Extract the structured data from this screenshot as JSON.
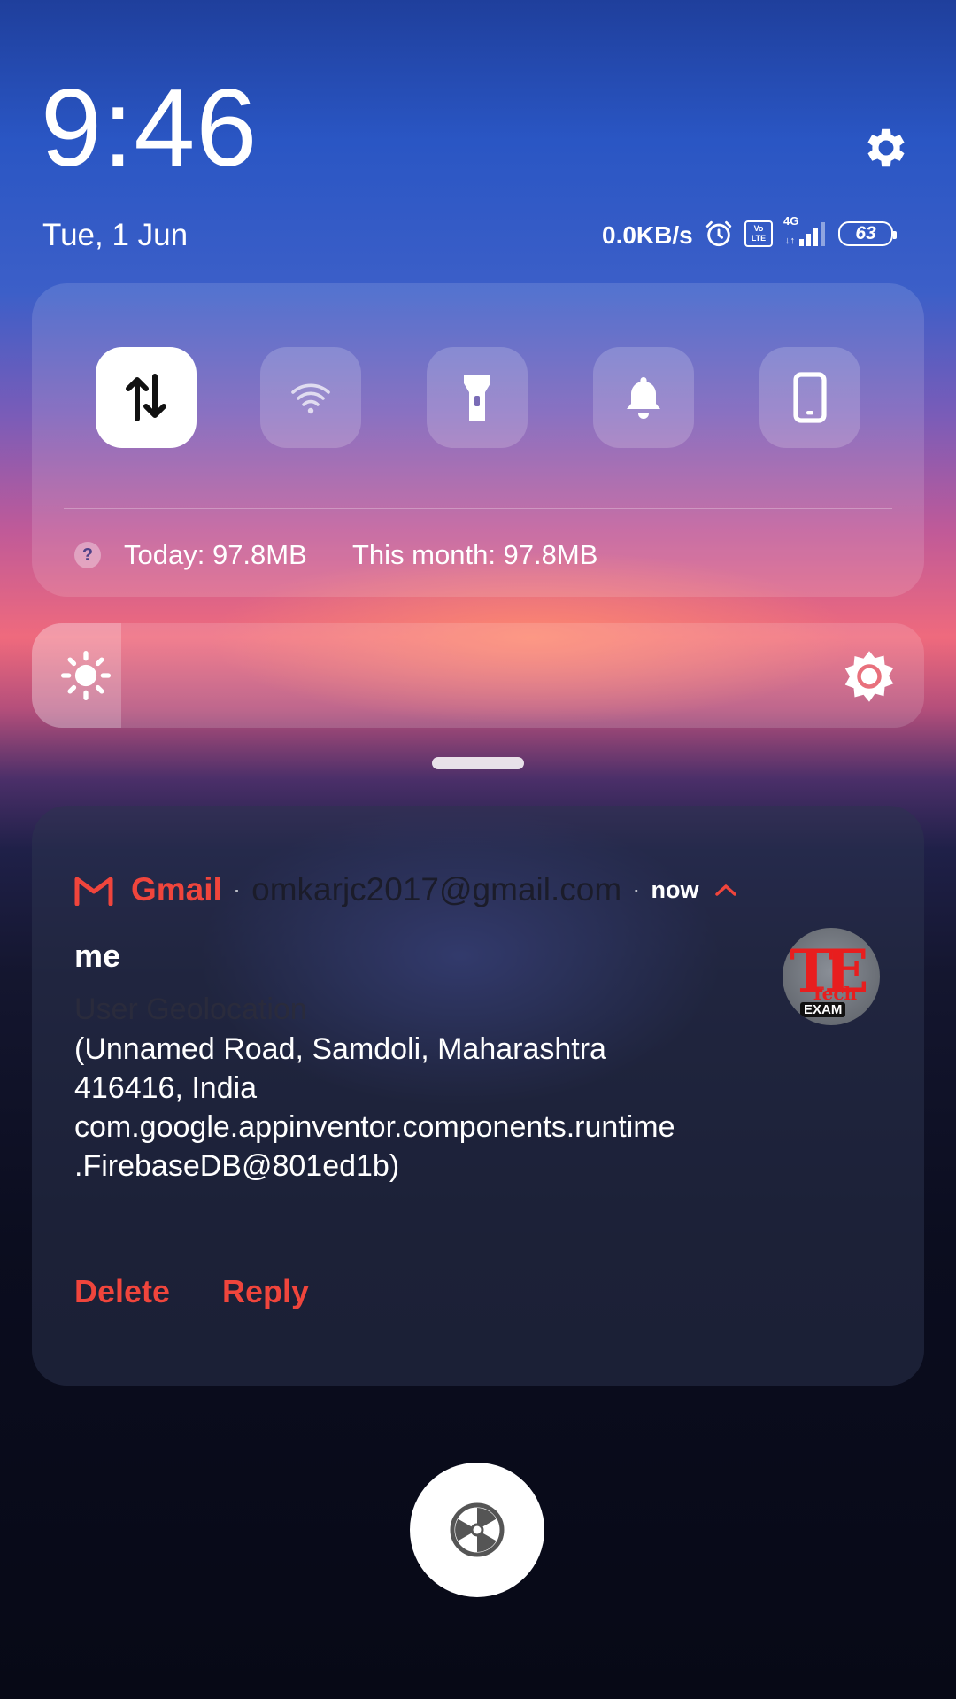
{
  "clock": {
    "time": "9:46",
    "date": "Tue, 1 Jun"
  },
  "status_bar": {
    "net_speed": "0.0KB/s",
    "network_type": "4G",
    "volte": "Vo LTE",
    "battery_level": "63",
    "icons": [
      "alarm-icon",
      "volte-icon",
      "signal-icon",
      "battery-icon"
    ]
  },
  "settings": {
    "icon": "gear-icon"
  },
  "quick_settings": {
    "tiles": [
      {
        "name": "mobile-data",
        "icon": "data-arrows-icon",
        "active": true
      },
      {
        "name": "wifi",
        "icon": "wifi-icon",
        "active": false
      },
      {
        "name": "flashlight",
        "icon": "flashlight-icon",
        "active": false
      },
      {
        "name": "sound",
        "icon": "bell-icon",
        "active": false
      },
      {
        "name": "screen",
        "icon": "phone-icon",
        "active": false
      }
    ],
    "usage": {
      "help_glyph": "?",
      "today": "Today: 97.8MB",
      "this_month": "This month: 97.8MB"
    }
  },
  "brightness": {
    "level_fraction": 0.1,
    "low_icon": "sun-small-icon",
    "high_icon": "sun-large-icon"
  },
  "notification": {
    "app_name": "Gmail",
    "separator": "·",
    "account": "omkarjc2017@gmail.com",
    "time": "now",
    "sender": "me",
    "subject": "User Geolocation",
    "body": "(Unnamed Road, Samdoli, Maharashtra\n416416, India\ncom.google.appinventor.components.runtime\n.FirebaseDB@801ed1b)",
    "avatar": {
      "logo_text": "TE",
      "caption": "Tech",
      "badge": "EXAM"
    },
    "actions": {
      "delete": "Delete",
      "reply": "Reply"
    },
    "accent_color": "#f0453c"
  },
  "bottom_button": {
    "icon": "aperture-icon"
  }
}
